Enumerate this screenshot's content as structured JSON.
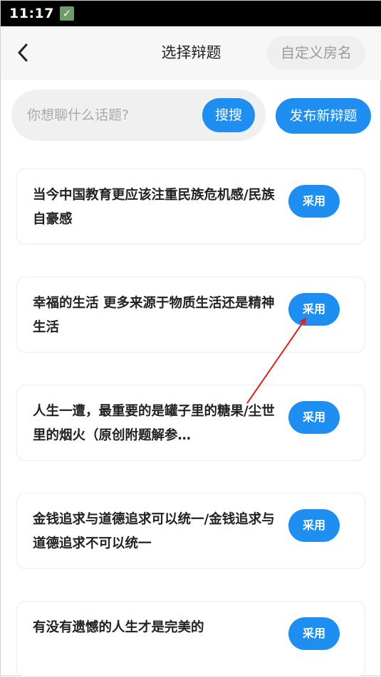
{
  "status_bar": {
    "time": "11:17",
    "notification_icon": "check-icon"
  },
  "header": {
    "back_icon": "chevron-left-icon",
    "title": "选择辩题",
    "custom_room_label": "自定义房名"
  },
  "search": {
    "placeholder": "你想聊什么话题?",
    "value": "",
    "button_label": "搜搜"
  },
  "publish_button_label": "发布新辩题",
  "topics": [
    {
      "text": "当今中国教育更应该注重民族危机感/民族自豪感",
      "button_label": "采用"
    },
    {
      "text": "幸福的生活 更多来源于物质生活还是精神生活",
      "button_label": "采用"
    },
    {
      "text": "人生一遭，最重要的是罐子里的糖果/尘世里的烟火（原创附题解参…",
      "button_label": "采用"
    },
    {
      "text": "金钱追求与道德追求可以统一/金钱追求与道德追求不可以统一",
      "button_label": "采用"
    },
    {
      "text": "有没有遗憾的人生才是完美的",
      "button_label": "采用"
    }
  ],
  "annotation": {
    "arrow_color": "#e02020"
  },
  "colors": {
    "accent": "#1e8ff0",
    "header_bg": "#f7f7f7",
    "search_bg": "#f0f0f0"
  }
}
